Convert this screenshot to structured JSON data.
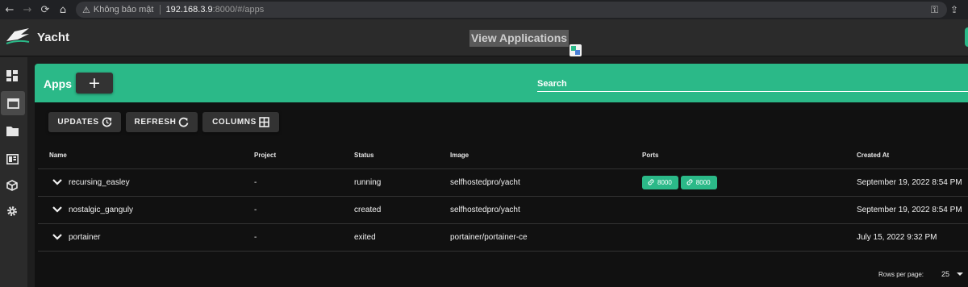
{
  "browser": {
    "not_secure": "Không bảo mật",
    "url_host": "192.168.3.9",
    "url_path": ":8000/#/apps"
  },
  "header": {
    "brand": "Yacht",
    "page_title": "View Applications"
  },
  "sidebar": {
    "items": [
      {
        "icon": "dashboard-icon"
      },
      {
        "icon": "apps-window-icon",
        "active": true
      },
      {
        "icon": "folder-icon"
      },
      {
        "icon": "templates-icon"
      },
      {
        "icon": "resources-cube-icon"
      },
      {
        "icon": "gear-icon"
      }
    ]
  },
  "toolbar": {
    "title": "Apps",
    "add_label": "+",
    "search_placeholder": "Search"
  },
  "actions": {
    "updates": "UPDATES",
    "refresh": "REFRESH",
    "columns": "COLUMNS"
  },
  "table": {
    "headers": {
      "name": "Name",
      "project": "Project",
      "status": "Status",
      "image": "Image",
      "ports": "Ports",
      "created": "Created At"
    },
    "rows": [
      {
        "name": "recursing_easley",
        "project": "-",
        "status": "running",
        "image": "selfhostedpro/yacht",
        "ports": [
          "8000",
          "8000"
        ],
        "created": "September 19, 2022 8:54 PM"
      },
      {
        "name": "nostalgic_ganguly",
        "project": "-",
        "status": "created",
        "image": "selfhostedpro/yacht",
        "ports": [],
        "created": "September 19, 2022 8:54 PM"
      },
      {
        "name": "portainer",
        "project": "-",
        "status": "exited",
        "image": "portainer/portainer-ce",
        "ports": [],
        "created": "July 15, 2022 9:32 PM"
      }
    ]
  },
  "pagination": {
    "rows_per_page_label": "Rows per page:",
    "rows_per_page": "25"
  },
  "colors": {
    "accent": "#2bb988",
    "background": "#111111",
    "header": "#2b2b2b"
  }
}
